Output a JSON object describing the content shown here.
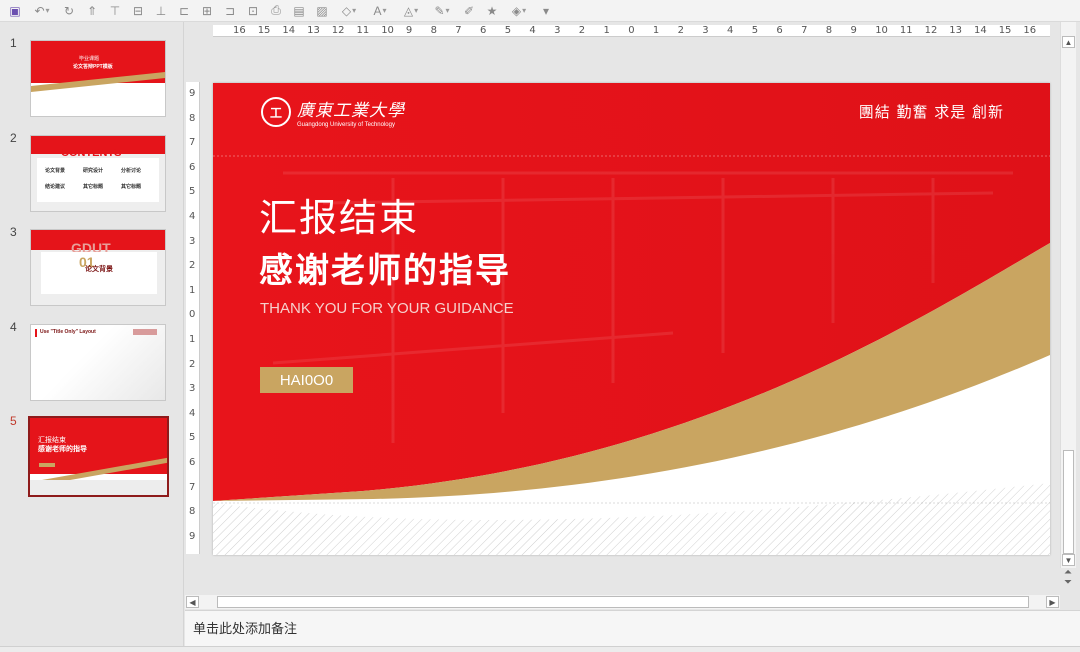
{
  "toolbar": {
    "icons": [
      "save-icon",
      "undo-icon",
      "redo-icon",
      "paste-format-icon",
      "align-top-icon",
      "align-middle-icon",
      "align-bottom-icon",
      "align-left-icon",
      "align-center-icon",
      "align-right-icon",
      "distribute-icon",
      "print-icon",
      "screenshot-icon",
      "picture-icon",
      "shape-icon",
      "font-color-icon",
      "fill-color-icon",
      "line-color-icon",
      "format-painter-icon",
      "effects-icon",
      "more-icon"
    ]
  },
  "thumbnails": [
    {
      "number": "1",
      "active": false,
      "kind": "cover",
      "title": "毕业课题",
      "subtitle": "论文答辩PPT模板"
    },
    {
      "number": "2",
      "active": false,
      "kind": "contents",
      "title": "CONTENTS",
      "items": [
        "论文背景",
        "研究设计",
        "分析讨论",
        "结论建议",
        "其它标题",
        "其它标题"
      ]
    },
    {
      "number": "3",
      "active": false,
      "kind": "section",
      "title": "GDUT",
      "big": "01",
      "label": "论文背景"
    },
    {
      "number": "4",
      "active": false,
      "kind": "blank",
      "title": "Use \"Title Only\" Layout"
    },
    {
      "number": "5",
      "active": true,
      "kind": "end",
      "title": "汇报结束",
      "subtitle": "感谢老师的指导"
    }
  ],
  "ruler": {
    "horizontal": [
      "16",
      "15",
      "14",
      "13",
      "12",
      "11",
      "10",
      "9",
      "8",
      "7",
      "6",
      "5",
      "4",
      "3",
      "2",
      "1",
      "0",
      "1",
      "2",
      "3",
      "4",
      "5",
      "6",
      "7",
      "8",
      "9",
      "10",
      "11",
      "12",
      "13",
      "14",
      "15",
      "16"
    ],
    "vertical": [
      "9",
      "8",
      "7",
      "6",
      "5",
      "4",
      "3",
      "2",
      "1",
      "0",
      "1",
      "2",
      "3",
      "4",
      "5",
      "6",
      "7",
      "8",
      "9"
    ]
  },
  "slide": {
    "logo_seal": "工",
    "logo_cn": "廣東工業大學",
    "logo_en": "Guangdong University of Technology",
    "motto": "團結 勤奮 求是 創新",
    "title_line1": "汇报结束",
    "title_line2": "感谢老师的指导",
    "subtitle": "THANK YOU FOR YOUR GUIDANCE",
    "author": "HAI0O0",
    "colors": {
      "red": "#e5141a",
      "gold": "#c9a561",
      "white": "#ffffff"
    }
  },
  "notes": {
    "placeholder": "单击此处添加备注"
  }
}
